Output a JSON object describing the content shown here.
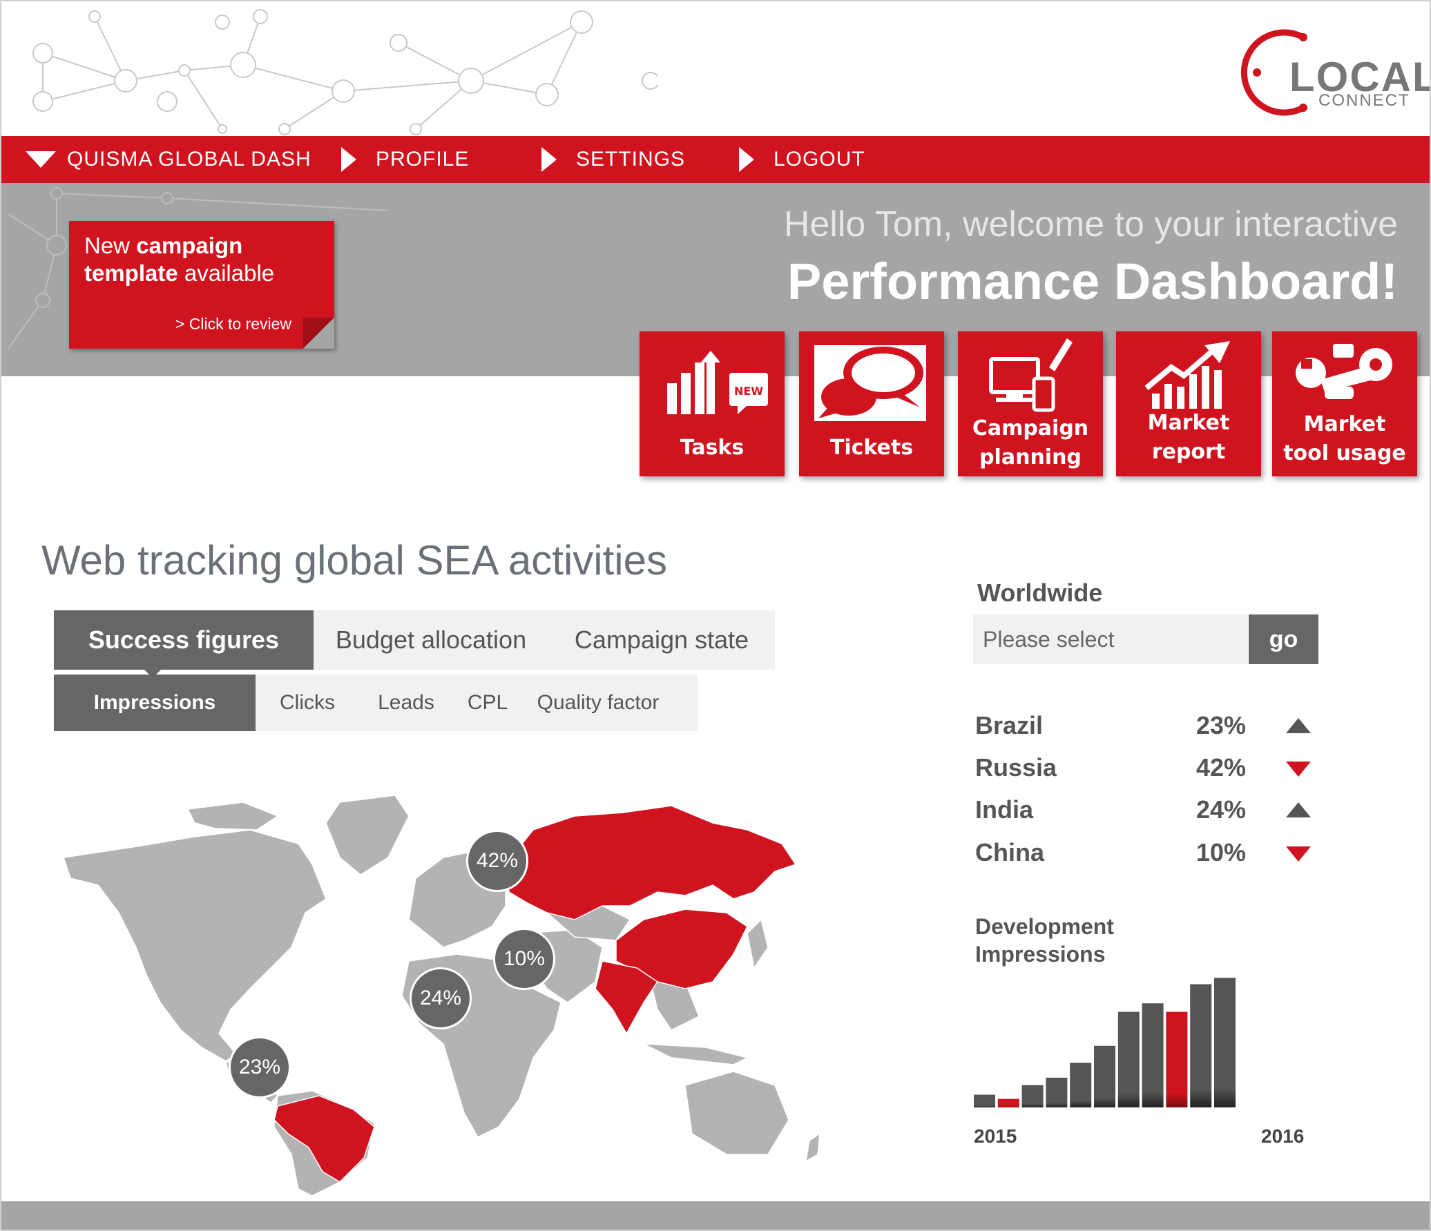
{
  "nav": {
    "items": [
      {
        "label": "QUISMA GLOBAL DASH"
      },
      {
        "label": "PROFILE"
      },
      {
        "label": "SETTINGS"
      },
      {
        "label": "LOGOUT"
      }
    ]
  },
  "logo": {
    "word1": "LOCAL",
    "word2": "CONNECT"
  },
  "hero": {
    "greeting": "Hello Tom, welcome to your interactive",
    "headline": "Performance Dashboard!"
  },
  "promo": {
    "line1_plain": "New ",
    "line1_bold": "campaign",
    "line2_bold": "template",
    "line2_plain": " available",
    "link": "> Click to review"
  },
  "tiles": [
    {
      "label": "Tasks",
      "badge": "NEW",
      "icon": "chart-growth-icon"
    },
    {
      "label": "Tickets",
      "icon": "speech-bubbles-icon"
    },
    {
      "label_line1": "Campaign",
      "label_line2": "planning",
      "icon": "devices-pen-icon"
    },
    {
      "label_line1": "Market",
      "label_line2": "report",
      "icon": "rising-chart-icon"
    },
    {
      "label_line1": "Market",
      "label_line2": "tool usage",
      "icon": "wrench-icon"
    }
  ],
  "section": {
    "title": "Web tracking global SEA activities"
  },
  "tabs": {
    "main": [
      {
        "label": "Success figures",
        "active": true
      },
      {
        "label": "Budget allocation",
        "active": false
      },
      {
        "label": "Campaign state",
        "active": false
      }
    ],
    "sub": [
      {
        "label": "Impressions",
        "active": true
      },
      {
        "label": "Clicks",
        "active": false
      },
      {
        "label": "Leads",
        "active": false
      },
      {
        "label": "CPL",
        "active": false
      },
      {
        "label": "Quality factor",
        "active": false
      }
    ]
  },
  "map": {
    "highlighted": [
      "Brazil",
      "Russia",
      "India",
      "China"
    ],
    "bubbles": [
      {
        "country": "Russia",
        "label": "42%"
      },
      {
        "country": "China",
        "label": "10%"
      },
      {
        "country": "India",
        "label": "24%"
      },
      {
        "country": "Brazil",
        "label": "23%"
      }
    ]
  },
  "panel": {
    "title": "Worldwide",
    "select_placeholder": "Please select",
    "go_label": "go",
    "stats": [
      {
        "country": "Brazil",
        "pct": "23%",
        "trend": "up"
      },
      {
        "country": "Russia",
        "pct": "42%",
        "trend": "down"
      },
      {
        "country": "India",
        "pct": "24%",
        "trend": "up"
      },
      {
        "country": "China",
        "pct": "10%",
        "trend": "down"
      }
    ],
    "dev_title_line1": "Development",
    "dev_title_line2": "Impressions"
  },
  "colors": {
    "accent": "#d0141f",
    "dark_gray": "#666666",
    "band_gray": "#a5a5a7"
  },
  "chart_data": {
    "type": "bar",
    "x_start_label": "2015",
    "x_end_label": "2016",
    "values": [
      12,
      8,
      21,
      28,
      42,
      58,
      90,
      98,
      90,
      116,
      122
    ],
    "highlighted": [
      false,
      true,
      false,
      false,
      false,
      false,
      false,
      false,
      true,
      false,
      false
    ],
    "ylim": [
      0,
      130
    ]
  }
}
